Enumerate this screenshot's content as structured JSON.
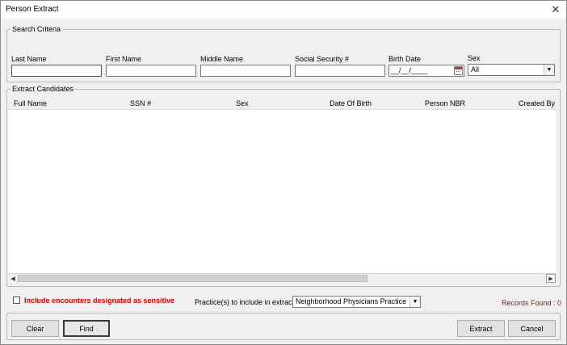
{
  "window": {
    "title": "Person Extract"
  },
  "search": {
    "legend": "Search Criteria",
    "last_name_label": "Last Name",
    "last_name_value": "",
    "first_name_label": "First Name",
    "first_name_value": "",
    "middle_name_label": "Middle Name",
    "middle_name_value": "",
    "ssn_label": "Social Security #",
    "ssn_value": "",
    "birth_date_label": "Birth Date",
    "birth_date_value": "__/__/____",
    "sex_label": "Sex",
    "sex_value": "All"
  },
  "candidates": {
    "legend": "Extract Candidates",
    "columns": [
      "Full Name",
      "SSN #",
      "Sex",
      "Date Of Birth",
      "Person NBR",
      "Created By"
    ],
    "rows": []
  },
  "options": {
    "sensitive_label": "Include encounters designated as sensitive",
    "sensitive_checked": false,
    "practice_label": "Practice(s) to include in extract:",
    "practice_value": "Neighborhood Physicians Practice",
    "records_found": "Records Found : 0"
  },
  "buttons": {
    "clear": "Clear",
    "find": "Find",
    "extract": "Extract",
    "cancel": "Cancel"
  },
  "icons": {
    "close": "close-icon",
    "calendar": "calendar-icon",
    "dropdown": "chevron-down-icon"
  },
  "colors": {
    "sensitive_text": "#e00000",
    "records_text": "#8b1a1a"
  }
}
